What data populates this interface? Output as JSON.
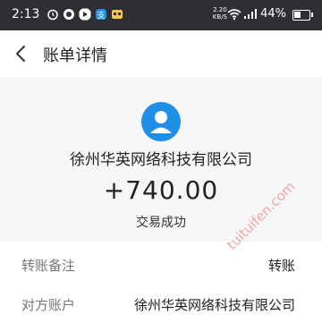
{
  "status_bar": {
    "time": "2:13",
    "network_speed_value": "2.20",
    "network_speed_unit": "KB/S",
    "signal": "4G",
    "battery_level": 44,
    "battery_text": "44%"
  },
  "nav": {
    "title": "账单详情"
  },
  "summary": {
    "merchant": "徐州华英网络科技有限公司",
    "amount": "+740.00",
    "status": "交易成功"
  },
  "details": [
    {
      "label": "转账备注",
      "value": "转账"
    },
    {
      "label": "对方账户",
      "value": "徐州华英网络科技有限公司"
    }
  ],
  "watermark": {
    "text": "tuituifen.com"
  },
  "colors": {
    "accent": "#1f8fe5",
    "status_bar": "#2f2f33",
    "background": "#f6f6f8",
    "watermark": "#f08a8a"
  }
}
